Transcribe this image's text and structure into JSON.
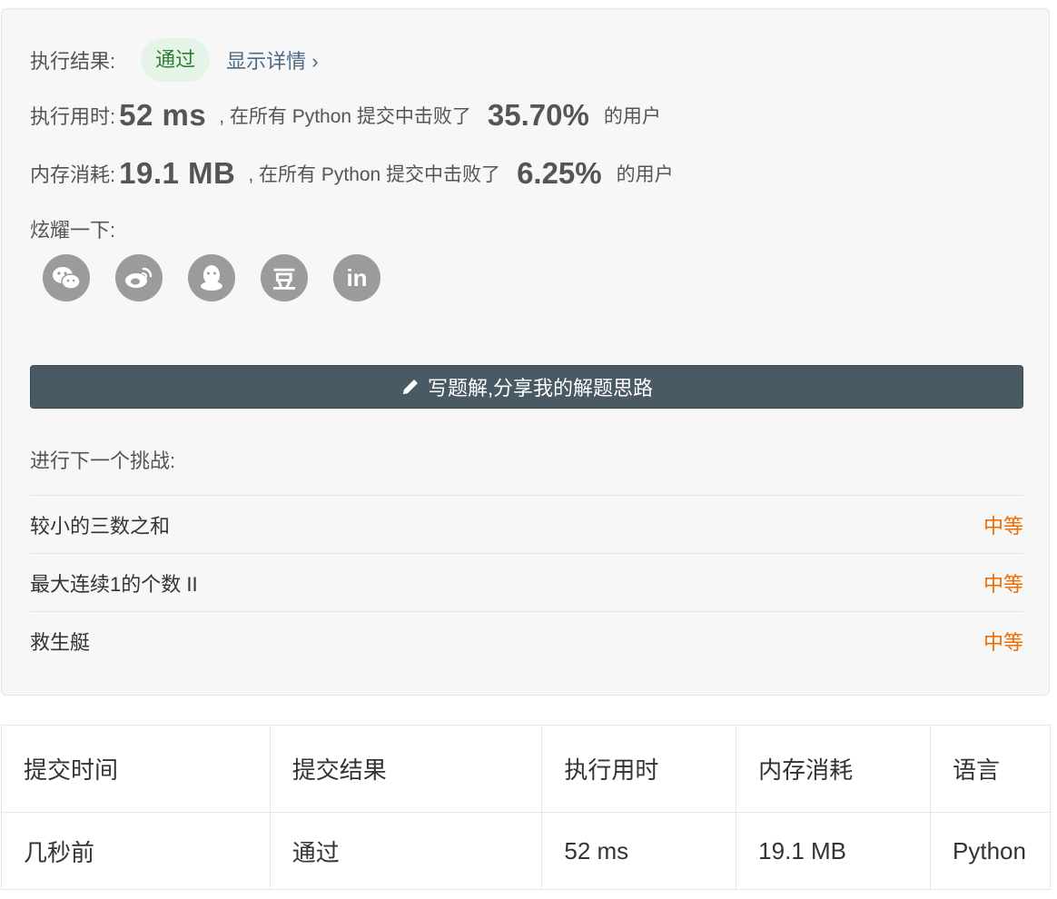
{
  "result": {
    "label": "执行结果:",
    "status": "通过",
    "details_link": "显示详情 ›"
  },
  "runtime": {
    "label": "执行用时:",
    "value": "52 ms",
    "middle": ", 在所有 Python 提交中击败了",
    "percent": "35.70%",
    "suffix": "的用户"
  },
  "memory": {
    "label": "内存消耗:",
    "value": "19.1 MB",
    "middle": ", 在所有 Python 提交中击败了",
    "percent": "6.25%",
    "suffix": "的用户"
  },
  "share": {
    "label": "炫耀一下:",
    "icons": [
      "wechat-icon",
      "weibo-icon",
      "qq-icon",
      "douban-icon",
      "linkedin-icon"
    ],
    "douban_glyph": "豆",
    "linkedin_glyph": "in"
  },
  "write_solution": {
    "label": "写题解,分享我的解题思路"
  },
  "next_challenge": {
    "title": "进行下一个挑战:",
    "items": [
      {
        "name": "较小的三数之和",
        "difficulty": "中等"
      },
      {
        "name": "最大连续1的个数 II",
        "difficulty": "中等"
      },
      {
        "name": "救生艇",
        "difficulty": "中等"
      }
    ]
  },
  "submissions": {
    "headers": [
      "提交时间",
      "提交结果",
      "执行用时",
      "内存消耗",
      "语言"
    ],
    "rows": [
      {
        "time": "几秒前",
        "result": "通过",
        "runtime": "52 ms",
        "memory": "19.1 MB",
        "language": "Python"
      }
    ]
  },
  "colors": {
    "accent_green": "#2e7d32",
    "difficulty_medium": "#ef6c00",
    "button_dark": "#4a5a64",
    "icon_gray": "#9b9b9b"
  }
}
